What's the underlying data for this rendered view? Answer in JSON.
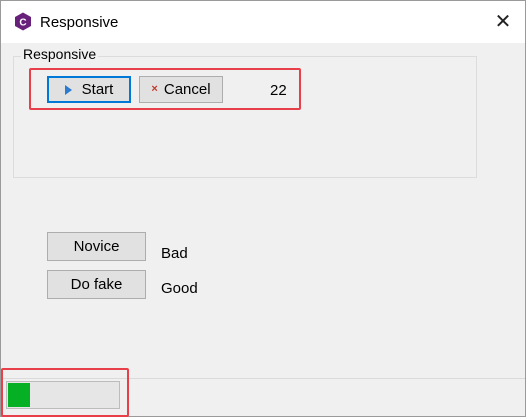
{
  "window": {
    "title": "Responsive",
    "close_glyph": "✕"
  },
  "group": {
    "label": "Responsive"
  },
  "buttons": {
    "start": "Start",
    "cancel": "Cancel",
    "cancel_glyph": "×",
    "novice": "Novice",
    "dofake": "Do fake"
  },
  "counter": "22",
  "status": {
    "novice": "Bad",
    "dofake": "Good"
  },
  "progress": {
    "value_fraction": 0.2,
    "fill_color": "#06b025"
  },
  "colors": {
    "accent": "#0078d7",
    "highlight": "#e8404a",
    "app_icon": "#68217a"
  }
}
